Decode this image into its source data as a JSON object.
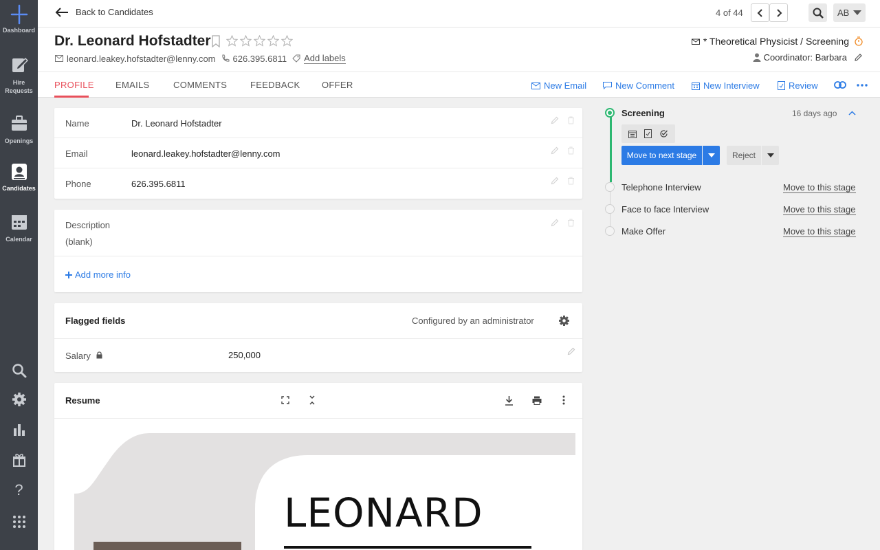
{
  "sidebar": {
    "items": [
      {
        "label": "Dashboard",
        "icon": "sparkle-icon"
      },
      {
        "label": "Hire\nRequests",
        "icon": "hire-requests-icon"
      },
      {
        "label": "Openings",
        "icon": "briefcase-icon"
      },
      {
        "label": "Candidates",
        "icon": "candidates-icon",
        "active": true
      },
      {
        "label": "Calendar",
        "icon": "calendar-icon"
      }
    ],
    "bottom_icons": [
      "search-icon",
      "gear-icon",
      "bar-chart-icon",
      "gift-icon",
      "help-icon",
      "apps-grid-icon"
    ]
  },
  "topbar": {
    "back_label": "Back to Candidates",
    "pager": "4 of 44",
    "avatar_initials": "AB"
  },
  "candidate": {
    "name": "Dr. Leonard Hofstadter",
    "email": "leonard.leakey.hofstadter@lenny.com",
    "phone": "626.395.6811",
    "add_labels": "Add labels",
    "job": "* Theoretical Physicist / Screening",
    "coordinator": "Coordinator: Barbara",
    "rating_max": 5,
    "rating": 0
  },
  "tabs": [
    "PROFILE",
    "EMAILS",
    "COMMENTS",
    "FEEDBACK",
    "OFFER"
  ],
  "actions": [
    "New Email",
    "New Comment",
    "New Interview",
    "Review"
  ],
  "profile": {
    "fields": [
      {
        "key": "Name",
        "value": "Dr. Leonard Hofstadter"
      },
      {
        "key": "Email",
        "value": "leonard.leakey.hofstadter@lenny.com"
      },
      {
        "key": "Phone",
        "value": "626.395.6811"
      }
    ],
    "description_label": "Description",
    "description_value": "(blank)",
    "add_more": "Add more info"
  },
  "flagged": {
    "title": "Flagged fields",
    "configured": "Configured by an administrator",
    "salary_label": "Salary",
    "salary_value": "250,000"
  },
  "resume": {
    "title": "Resume",
    "doc_name": "LEONARD"
  },
  "pipeline": {
    "current_stage": "Screening",
    "current_age": "16 days ago",
    "move_next": "Move to next stage",
    "reject": "Reject",
    "stages": [
      {
        "name": "Telephone Interview",
        "link": "Move to this stage"
      },
      {
        "name": "Face to face Interview",
        "link": "Move to this stage"
      },
      {
        "name": "Make Offer",
        "link": "Move to this stage"
      }
    ]
  },
  "colors": {
    "accent": "#2c7be5",
    "tab_active": "#e8505b",
    "stage_green": "#2eb872",
    "sidebar": "#3d4148"
  }
}
